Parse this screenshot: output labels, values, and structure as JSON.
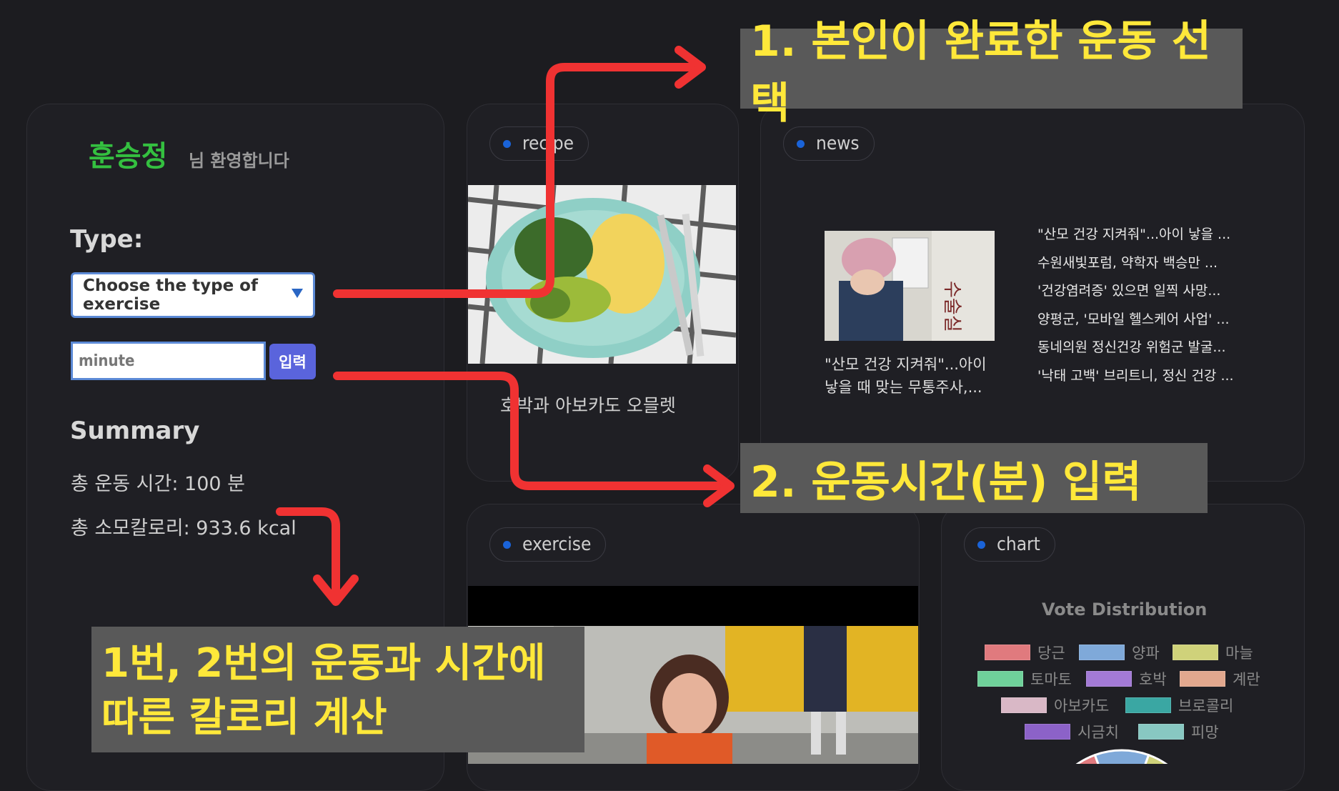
{
  "sidebar": {
    "user_name": "훈승정",
    "welcome_suffix": "님 환영합니다",
    "type_label": "Type:",
    "select_value": "Choose the type of exercise",
    "minute_placeholder": "minute",
    "submit_label": "입력",
    "summary_label": "Summary",
    "total_time": "총 운동 시간: 100 분",
    "total_calories": "총 소모칼로리: 933.6 kcal"
  },
  "recipe": {
    "tag": "recipe",
    "title": "호박과 아보카도 오믈렛"
  },
  "news": {
    "tag": "news",
    "caption": "\"산모 건강 지켜줘\"...아이 낳을 때 맞는 무통주사,...",
    "items": [
      "\"산모 건강 지켜줘\"...아이 낳을 ...",
      "수원새빛포럼, 약학자 백승만 ...",
      "'건강염려증' 있으면 일찍 사망...",
      "양평군, '모바일 헬스케어 사업' ...",
      "동네의원 정신건강 위험군 발굴...",
      "'낙태 고백' 브리트니, 정신 건강 ..."
    ]
  },
  "exercise": {
    "tag": "exercise"
  },
  "chart": {
    "tag": "chart",
    "title": "Vote Distribution",
    "colors": [
      "#e07a7e",
      "#7fa9d9",
      "#cfd27a",
      "#6fd19a",
      "#a37ad6",
      "#e2a88e",
      "#d9b8c6",
      "#3aa7a3",
      "#8c62c8",
      "#88c8c2"
    ]
  },
  "chart_data": {
    "type": "pie",
    "title": "Vote Distribution",
    "categories": [
      "당근",
      "양파",
      "마늘",
      "토마토",
      "호박",
      "계란",
      "아보카도",
      "브로콜리",
      "시금치",
      "피망"
    ],
    "values": [],
    "legend": "top"
  },
  "callouts": {
    "one": "1. 본인이 완료한 운동 선택",
    "two": "2. 운동시간(분) 입력",
    "three_line1": "1번, 2번의 운동과 시간에",
    "three_line2": "따른 칼로리 계산"
  }
}
